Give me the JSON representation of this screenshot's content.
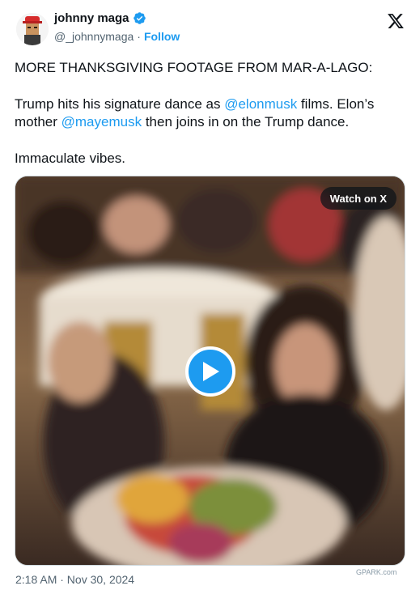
{
  "author": {
    "display_name": "johnny maga",
    "handle": "@_johnnymaga",
    "separator": "·",
    "follow_label": "Follow"
  },
  "tweet": {
    "line1": "MORE THANKSGIVING FOOTAGE FROM MAR-A-LAGO:",
    "para2_part1": "Trump hits his signature dance as ",
    "mention1": "@elonmusk",
    "para2_part2": " films. Elon’s mother ",
    "mention2": "@mayemusk",
    "para2_part3": " then joins in on the Trump dance.",
    "line3": "Immaculate vibes."
  },
  "media": {
    "watch_label": "Watch on X"
  },
  "timestamp": "2:18 AM · Nov 30, 2024",
  "watermark": "GPARK.com",
  "colors": {
    "accent": "#1d9bf0",
    "text": "#0f1419",
    "muted": "#536471"
  },
  "icons": [
    "verified-icon",
    "x-logo-icon",
    "play-icon"
  ]
}
